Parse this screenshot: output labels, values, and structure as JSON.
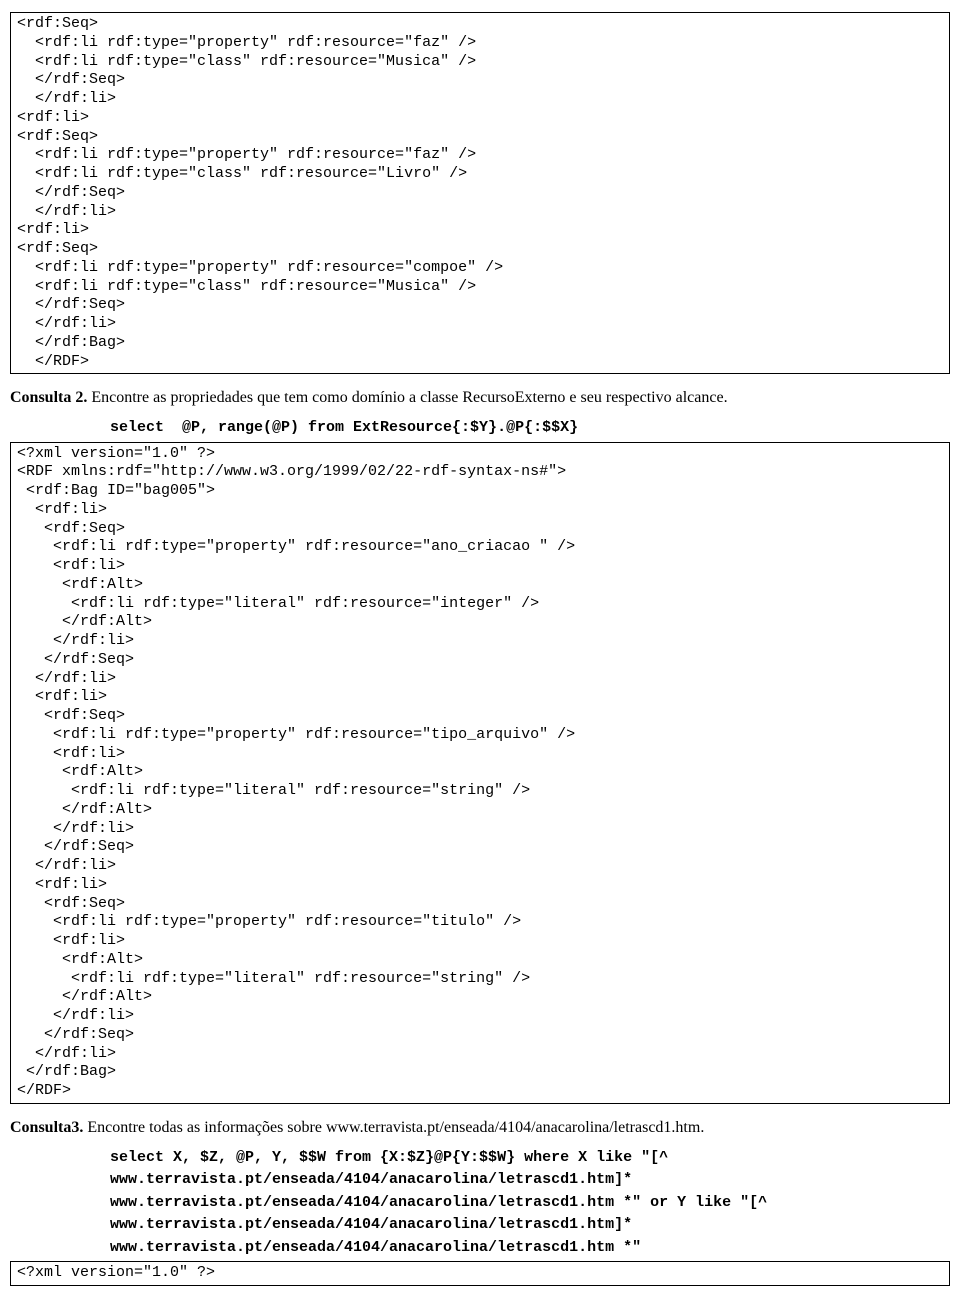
{
  "box1": "<rdf:Seq>\n  <rdf:li rdf:type=\"property\" rdf:resource=\"faz\" />\n  <rdf:li rdf:type=\"class\" rdf:resource=\"Musica\" />\n  </rdf:Seq>\n  </rdf:li>\n<rdf:li>\n<rdf:Seq>\n  <rdf:li rdf:type=\"property\" rdf:resource=\"faz\" />\n  <rdf:li rdf:type=\"class\" rdf:resource=\"Livro\" />\n  </rdf:Seq>\n  </rdf:li>\n<rdf:li>\n<rdf:Seq>\n  <rdf:li rdf:type=\"property\" rdf:resource=\"compoe\" />\n  <rdf:li rdf:type=\"class\" rdf:resource=\"Musica\" />\n  </rdf:Seq>\n  </rdf:li>\n  </rdf:Bag>\n  </RDF>",
  "consulta2": {
    "label": "Consulta 2.",
    "text": " Encontre as propriedades que tem como domínio a classe RecursoExterno e seu respectivo alcance.",
    "query": "select  @P, range(@P) from ExtResource{:$Y}.@P{:$$X}"
  },
  "box2": "<?xml version=\"1.0\" ?>\n<RDF xmlns:rdf=\"http://www.w3.org/1999/02/22-rdf-syntax-ns#\">\n <rdf:Bag ID=\"bag005\">\n  <rdf:li>\n   <rdf:Seq>\n    <rdf:li rdf:type=\"property\" rdf:resource=\"ano_criacao \" />\n    <rdf:li>\n     <rdf:Alt>\n      <rdf:li rdf:type=\"literal\" rdf:resource=\"integer\" />\n     </rdf:Alt>\n    </rdf:li>\n   </rdf:Seq>\n  </rdf:li>\n  <rdf:li>\n   <rdf:Seq>\n    <rdf:li rdf:type=\"property\" rdf:resource=\"tipo_arquivo\" />\n    <rdf:li>\n     <rdf:Alt>\n      <rdf:li rdf:type=\"literal\" rdf:resource=\"string\" />\n     </rdf:Alt>\n    </rdf:li>\n   </rdf:Seq>\n  </rdf:li>\n  <rdf:li>\n   <rdf:Seq>\n    <rdf:li rdf:type=\"property\" rdf:resource=\"titulo\" />\n    <rdf:li>\n     <rdf:Alt>\n      <rdf:li rdf:type=\"literal\" rdf:resource=\"string\" />\n     </rdf:Alt>\n    </rdf:li>\n   </rdf:Seq>\n  </rdf:li>\n </rdf:Bag>\n</RDF>",
  "consulta3": {
    "label": "Consulta3.",
    "text": " Encontre todas as informações sobre www.terravista.pt/enseada/4104/anacarolina/letrascd1.htm.",
    "query": "select X, $Z, @P, Y, $$W from {X:$Z}@P{Y:$$W} where X like \"[^\nwww.terravista.pt/enseada/4104/anacarolina/letrascd1.htm]*\nwww.terravista.pt/enseada/4104/anacarolina/letrascd1.htm *\" or Y like \"[^\nwww.terravista.pt/enseada/4104/anacarolina/letrascd1.htm]*\nwww.terravista.pt/enseada/4104/anacarolina/letrascd1.htm *\""
  },
  "box3": "<?xml version=\"1.0\" ?>"
}
